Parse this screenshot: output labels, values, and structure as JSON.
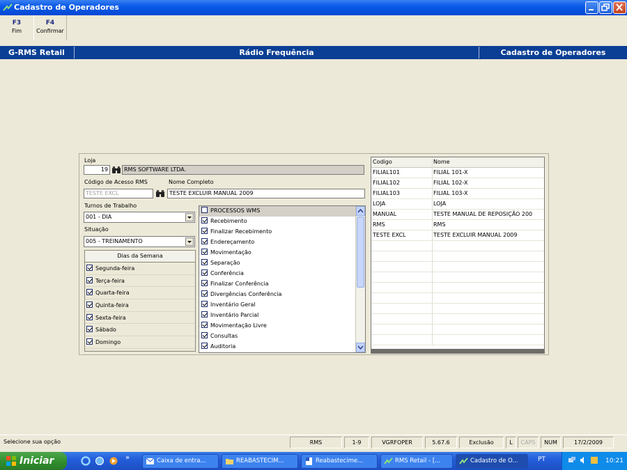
{
  "window": {
    "title": "Cadastro de Operadores"
  },
  "toolbar": {
    "f3_key": "F3",
    "f3_label": "Fim",
    "f4_key": "F4",
    "f4_label": "Confirmar"
  },
  "header": {
    "left": "G-RMS Retail",
    "center": "Rádio Frequência",
    "right": "Cadastro de Operadores"
  },
  "form": {
    "loja_label": "Loja",
    "loja_code": "19",
    "loja_name": "RMS SOFTWARE LTDA.",
    "codigo_label": "Código de Acesso RMS",
    "codigo_value": "TESTE EXCL",
    "nome_label": "Nome Completo",
    "nome_value": "TESTE EXCLUIR MANUAL 2009",
    "turnos_label": "Turnos de Trabalho",
    "turnos_value": "001 - DIA",
    "situacao_label": "Situação",
    "situacao_value": "005 - TREINAMENTO"
  },
  "dias": {
    "header": "Dias da Semana",
    "items": [
      {
        "label": "Segunda-feira",
        "checked": true
      },
      {
        "label": "Terça-feira",
        "checked": true
      },
      {
        "label": "Quarta-feira",
        "checked": true
      },
      {
        "label": "Quinta-feira",
        "checked": true
      },
      {
        "label": "Sexta-feira",
        "checked": true
      },
      {
        "label": "Sábado",
        "checked": true
      },
      {
        "label": "Domingo",
        "checked": true
      }
    ]
  },
  "processos": {
    "header": "PROCESSOS WMS",
    "items": [
      {
        "label": "Recebimento",
        "checked": true
      },
      {
        "label": "Finalizar Recebimento",
        "checked": true
      },
      {
        "label": "Endereçamento",
        "checked": true
      },
      {
        "label": "Movimentação",
        "checked": true
      },
      {
        "label": "Separação",
        "checked": true
      },
      {
        "label": "Conferência",
        "checked": true
      },
      {
        "label": "Finalizar Conferência",
        "checked": true
      },
      {
        "label": "Divergências Conferência",
        "checked": true
      },
      {
        "label": "Inventário Geral",
        "checked": true
      },
      {
        "label": "Inventário Parcial",
        "checked": true
      },
      {
        "label": "Movimentação Livre",
        "checked": true
      },
      {
        "label": "Consultas",
        "checked": true
      },
      {
        "label": "Auditoria",
        "checked": true
      }
    ]
  },
  "grid": {
    "col_codigo": "Codigo",
    "col_nome": "Nome",
    "rows": [
      {
        "codigo": "FILIAL101",
        "nome": "FILIAL 101-X"
      },
      {
        "codigo": "FILIAL102",
        "nome": "FILIAL 102-X"
      },
      {
        "codigo": "FILIAL103",
        "nome": "FILIAL 103-X"
      },
      {
        "codigo": "LOJA",
        "nome": "LOJA"
      },
      {
        "codigo": "MANUAL",
        "nome": "TESTE MANUAL DE REPOSIÇÃO 200"
      },
      {
        "codigo": "RMS",
        "nome": "RMS"
      },
      {
        "codigo": "TESTE EXCL",
        "nome": "TESTE EXCLUIR MANUAL 2009"
      }
    ]
  },
  "status": {
    "message": "Selecione sua opção",
    "user": "RMS",
    "range": "1-9",
    "program": "VGRFOPER",
    "version": "5.67.6",
    "mode": "Exclusão",
    "l": "L",
    "caps": "CAPS",
    "num": "NUM",
    "date": "17/2/2009"
  },
  "taskbar": {
    "start": "Iniciar",
    "overflow": "»",
    "buttons": [
      {
        "label": "Caixa de entra..."
      },
      {
        "label": "REABASTECIM..."
      },
      {
        "label": "Reabastecime..."
      },
      {
        "label": "RMS Retail - [..."
      },
      {
        "label": "Cadastro de O..."
      }
    ],
    "lang": "PT",
    "clock": "10:21"
  }
}
